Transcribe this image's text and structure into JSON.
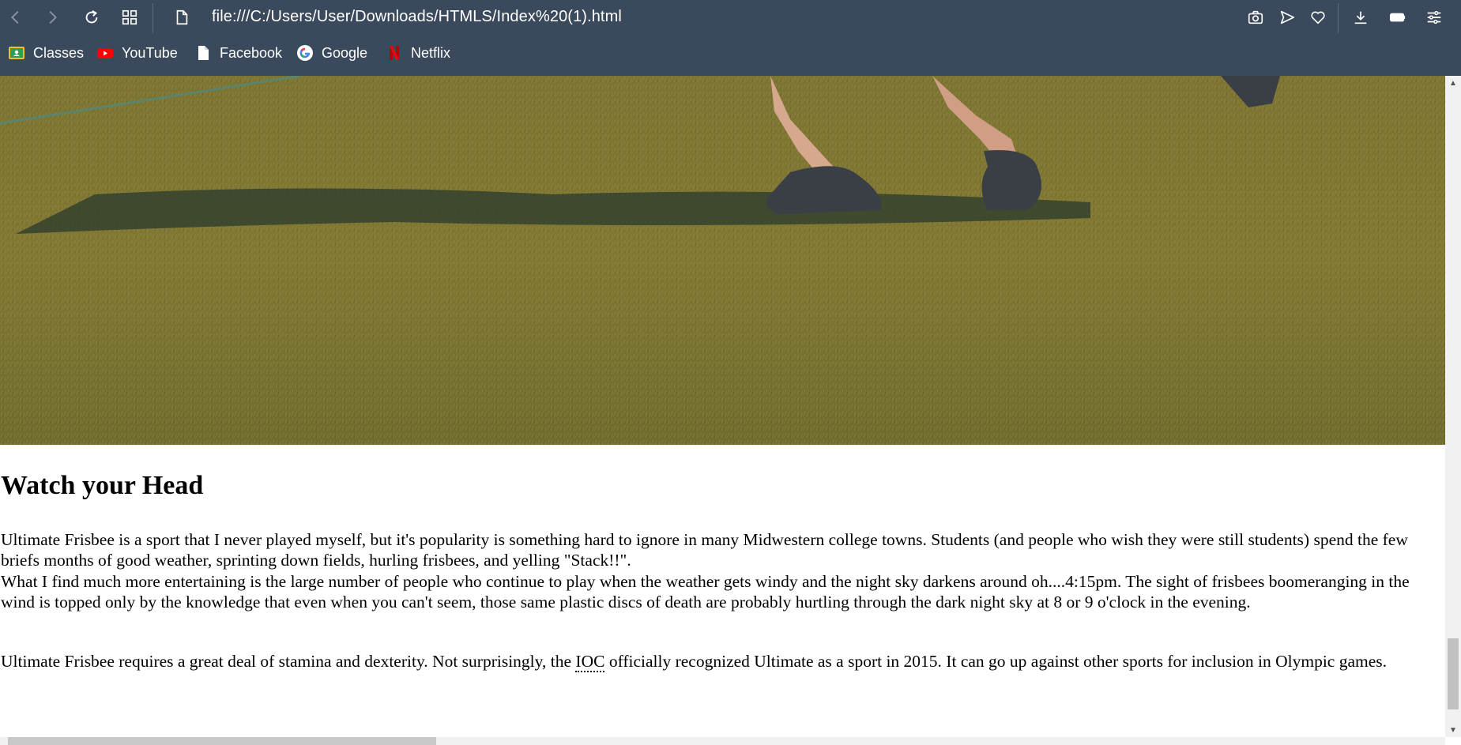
{
  "browser": {
    "url": "file:///C:/Users/User/Downloads/HTMLS/Index%20(1).html",
    "bookmarks": [
      {
        "label": "Classes",
        "icon": "google-classroom-icon"
      },
      {
        "label": "YouTube",
        "icon": "youtube-icon"
      },
      {
        "label": "Facebook",
        "icon": "page-icon"
      },
      {
        "label": "Google",
        "icon": "google-icon"
      },
      {
        "label": "Netflix",
        "icon": "netflix-icon"
      }
    ],
    "colors": {
      "chrome": "#3a4a5c",
      "text": "#ffffff"
    }
  },
  "article": {
    "hero_alt": "Frisbee player running on grass field",
    "heading": "Watch your Head",
    "p1": "Ultimate Frisbee is a sport that I never played myself, but it's popularity is something hard to ignore in many Midwestern college towns. Students (and people who wish they were still students) spend the few briefs months of good weather, sprinting down fields, hurling frisbees, and yelling \"Stack!!\".",
    "p2": "What I find much more entertaining is the large number of people who continue to play when the weather gets windy and the night sky darkens around oh....4:15pm. The sight of frisbees boomeranging in the wind is topped only by the knowledge that even when you can't seem, those same plastic discs of death are probably hurtling through the dark night sky at 8 or 9 o'clock in the evening.",
    "p3_before": "Ultimate Frisbee requires a great deal of stamina and dexterity. Not surprisingly, the ",
    "p3_abbr": "IOC",
    "p3_after": " officially recognized Ultimate as a sport in 2015. It can go up against other sports for inclusion in Olympic games."
  }
}
